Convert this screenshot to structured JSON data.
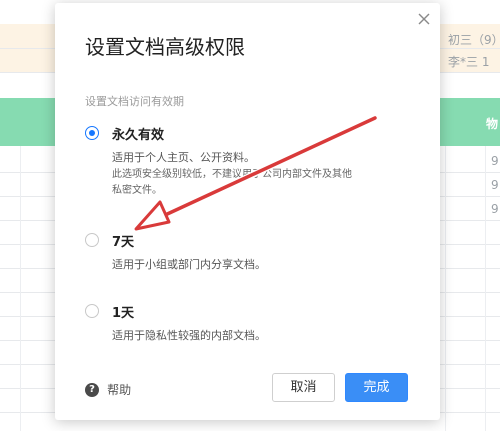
{
  "background": {
    "right_col_top": [
      "初三（9）",
      "李*三  1"
    ],
    "header_label": "物",
    "side_values": [
      "9",
      "9",
      "9"
    ],
    "colors": {
      "header": "#86dbb1",
      "warn_band": "#fdf3e4"
    }
  },
  "dialog": {
    "title": "设置文档高级权限",
    "section_label": "设置文档访问有效期",
    "options": [
      {
        "title": "永久有效",
        "desc": "适用于个人主页、公开资料。",
        "note": "此选项安全级别较低，不建议用于公司内部文件及其他私密文件。",
        "selected": true
      },
      {
        "title": "7天",
        "desc": "适用于小组或部门内分享文档。",
        "selected": false
      },
      {
        "title": "1天",
        "desc": "适用于隐私性较强的内部文档。",
        "selected": false
      }
    ],
    "help_label": "帮助",
    "help_icon": "question-circle-icon",
    "cancel_label": "取消",
    "ok_label": "完成",
    "close_icon": "close-icon",
    "accent_color": "#1677ff"
  },
  "annotation": {
    "type": "red-arrow",
    "color": "#d93a3a"
  }
}
